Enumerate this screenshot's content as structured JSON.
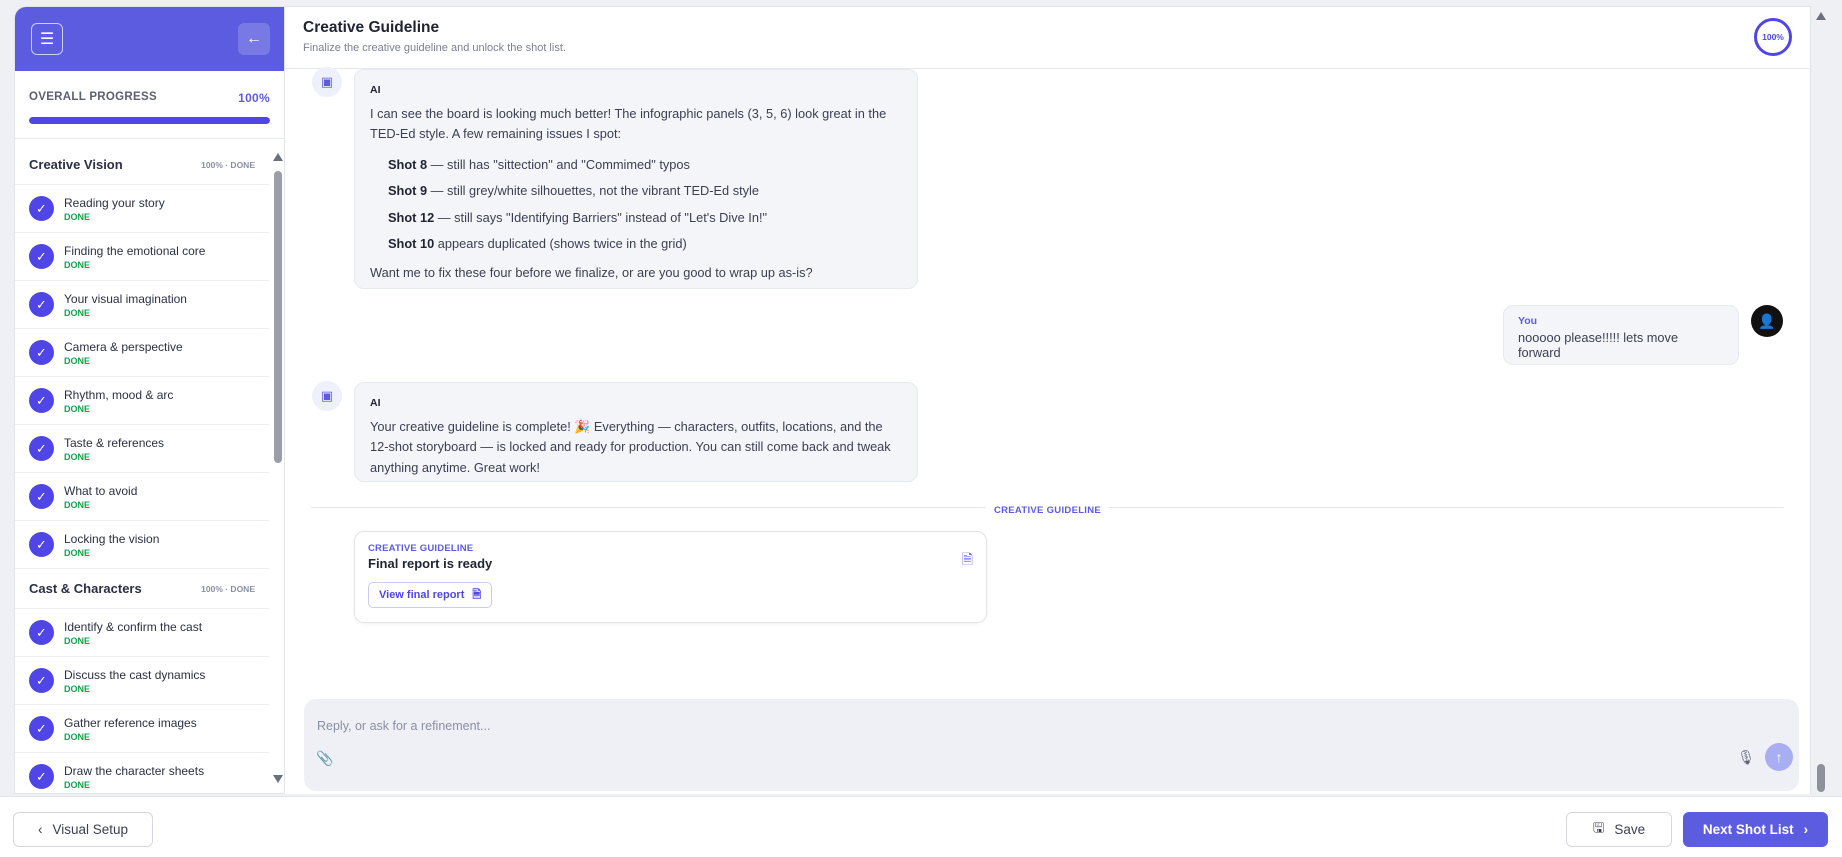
{
  "sidebar": {
    "progress_label": "OVERALL PROGRESS",
    "progress_value": "100%",
    "progress_fraction": 1.0,
    "sections": [
      {
        "name": "Creative Vision",
        "meta": "100% · DONE",
        "steps": [
          {
            "label": "Reading your story",
            "status": "DONE"
          },
          {
            "label": "Finding the emotional core",
            "status": "DONE"
          },
          {
            "label": "Your visual imagination",
            "status": "DONE"
          },
          {
            "label": "Camera & perspective",
            "status": "DONE"
          },
          {
            "label": "Rhythm, mood & arc",
            "status": "DONE"
          },
          {
            "label": "Taste & references",
            "status": "DONE"
          },
          {
            "label": "What to avoid",
            "status": "DONE"
          },
          {
            "label": "Locking the vision",
            "status": "DONE"
          }
        ]
      },
      {
        "name": "Cast & Characters",
        "meta": "100% · DONE",
        "steps": [
          {
            "label": "Identify & confirm the cast",
            "status": "DONE"
          },
          {
            "label": "Discuss the cast dynamics",
            "status": "DONE"
          },
          {
            "label": "Gather reference images",
            "status": "DONE"
          },
          {
            "label": "Draw the character sheets",
            "status": "DONE"
          }
        ]
      }
    ]
  },
  "header": {
    "title": "Creative Guideline",
    "subtitle": "Finalize the creative guideline and unlock the shot list.",
    "progress_ring": "100%"
  },
  "chat": {
    "msg1": {
      "who": "AI",
      "intro": "I can see the board is looking much better! The infographic panels (3, 5, 6) look great in the TED-Ed style. A few remaining issues I spot:",
      "issues": [
        {
          "shot": "Shot 8",
          "text": " — still has \"sittection\" and \"Commimed\" typos"
        },
        {
          "shot": "Shot 9",
          "text": " — still grey/white silhouettes, not the vibrant TED-Ed style"
        },
        {
          "shot": "Shot 12",
          "text": " — still says \"Identifying Barriers\" instead of \"Let's Dive In!\""
        },
        {
          "shot": "Shot 10",
          "text": " appears duplicated (shows twice in the grid)"
        }
      ],
      "outro": "Want me to fix these four before we finalize, or are you good to wrap up as-is?"
    },
    "msg2": {
      "who": "You",
      "text": "nooooo please!!!!! lets move forward"
    },
    "msg3": {
      "who": "AI",
      "text": "Your creative guideline is complete! 🎉 Everything — characters, outfits, locations, and the 12-shot storyboard — is locked and ready for production. You can still come back and tweak anything anytime. Great work!"
    },
    "divider_label": "CREATIVE GUIDELINE",
    "card": {
      "kicker": "CREATIVE GUIDELINE",
      "title": "Final report is ready",
      "button": "View final report"
    },
    "composer_placeholder": "Reply, or ask for a refinement..."
  },
  "footer": {
    "back_label": "Visual Setup",
    "save_label": "Save",
    "next_label": "Next Shot List"
  },
  "colors": {
    "accent": "#5b5cdf",
    "done": "#16a34a"
  }
}
